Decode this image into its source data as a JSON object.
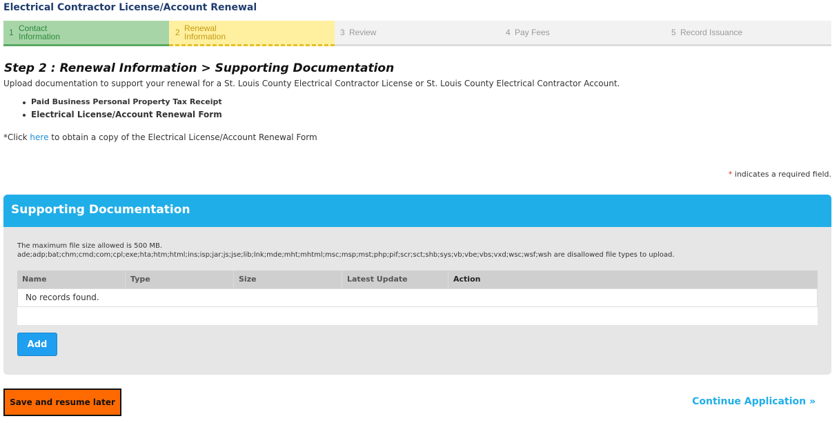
{
  "app": {
    "title": "Electrical Contractor License/Account Renewal"
  },
  "steps": [
    {
      "num": "1",
      "label_line1": "Contact",
      "label_line2": "Information",
      "state": "done"
    },
    {
      "num": "2",
      "label_line1": "Renewal",
      "label_line2": "Information",
      "state": "current"
    },
    {
      "num": "3",
      "label": "Review",
      "state": "todo"
    },
    {
      "num": "4",
      "label": "Pay Fees",
      "state": "todo"
    },
    {
      "num": "5",
      "label": "Record Issuance",
      "state": "todo"
    }
  ],
  "page": {
    "title": "Step 2 : Renewal Information > Supporting Documentation",
    "intro": "Upload documentation to support your renewal for a St. Louis County Electrical Contractor License or St. Louis County Electrical Contractor Account.",
    "bullets": [
      "Paid Business Personal Property Tax Receipt",
      "Electrical License/Account Renewal Form"
    ],
    "click_prefix": "*Click ",
    "click_link": "here",
    "click_suffix": " to obtain a copy of the Electrical License/Account Renewal Form",
    "required_star": "*",
    "required_text": " indicates a required field."
  },
  "panel": {
    "title": "Supporting Documentation",
    "max_size": "The maximum file size allowed is 500 MB.",
    "disallowed": "ade;adp;bat;chm;cmd;com;cpl;exe;hta;htm;html;ins;isp;jar;js;jse;lib;lnk;mde;mht;mhtml;msc;msp;mst;php;pif;scr;sct;shb;sys;vb;vbe;vbs;vxd;wsc;wsf;wsh are disallowed file types to upload.",
    "columns": [
      "Name",
      "Type",
      "Size",
      "Latest Update",
      "Action"
    ],
    "empty_text": "No records found.",
    "add_label": "Add"
  },
  "footer": {
    "save_label": "Save and resume later",
    "continue_label": "Continue Application »"
  },
  "colors": {
    "accent": "#20aee8",
    "step_done": "#a8d5a8",
    "step_current": "#fff0a0",
    "save_button": "#ff6a00"
  }
}
